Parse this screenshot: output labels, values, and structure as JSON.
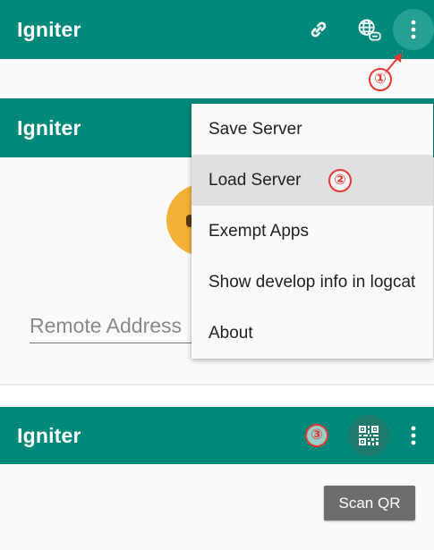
{
  "screen1": {
    "title": "Igniter",
    "icons": [
      "link-icon",
      "globe-link-icon",
      "overflow-menu-icon"
    ],
    "callout": "①"
  },
  "screen2": {
    "title": "Igniter",
    "menu": {
      "items": [
        {
          "label": "Save Server"
        },
        {
          "label": "Load Server"
        },
        {
          "label": "Exempt Apps"
        },
        {
          "label": "Show develop info in logcat"
        },
        {
          "label": "About"
        }
      ],
      "selected": "Load Server"
    },
    "callout": "②",
    "remote_address_hint": "Remote Address"
  },
  "screen3": {
    "title": "Igniter",
    "icons": [
      "qr-code-icon",
      "overflow-menu-icon"
    ],
    "callout": "③",
    "scan_button_label": "Scan QR"
  },
  "colors": {
    "toolbar": "#00897b",
    "callout": "#e53935",
    "menu_selected": "#e0e0e0",
    "button": "#6d6d6d",
    "avatar": "#f4b13a"
  }
}
